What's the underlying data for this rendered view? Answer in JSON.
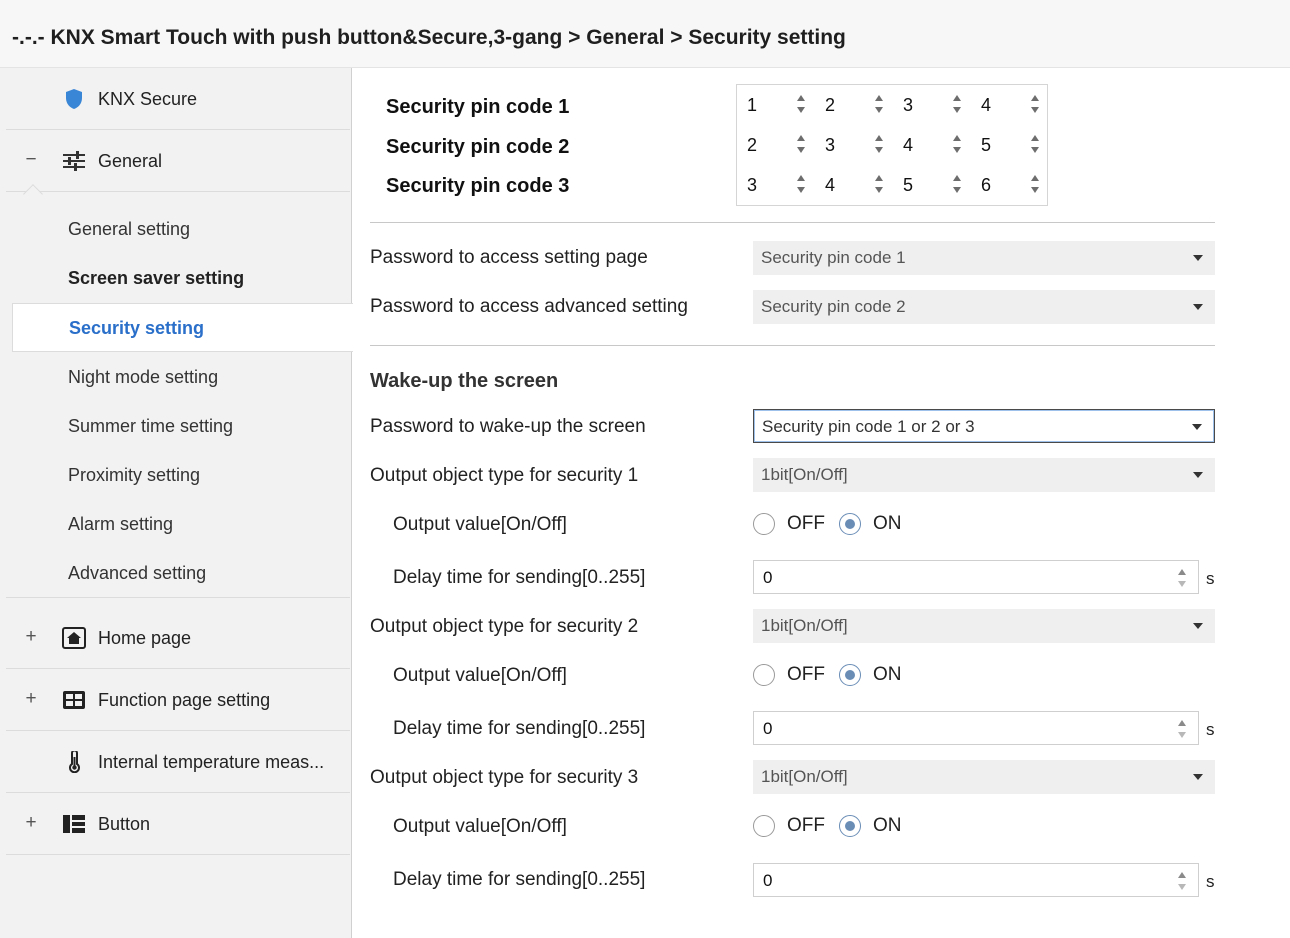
{
  "header": {
    "breadcrumb": "-.-.- KNX Smart Touch with push button&Secure,3-gang > General > Security setting"
  },
  "sidebar": {
    "knx_secure": "KNX Secure",
    "general": {
      "toggle": "−",
      "label": "General"
    },
    "general_items": [
      "General setting",
      "Screen saver setting",
      "Security setting",
      "Night mode setting",
      "Summer time setting",
      "Proximity setting",
      "Alarm setting",
      "Advanced setting"
    ],
    "home_page": {
      "toggle": "+",
      "label": "Home page"
    },
    "function_page": {
      "toggle": "+",
      "label": "Function page setting"
    },
    "internal_temp": {
      "label": "Internal temperature meas..."
    },
    "button": {
      "toggle": "+",
      "label": "Button"
    }
  },
  "pins": {
    "labels": [
      "Security pin code 1",
      "Security pin code 2",
      "Security pin code 3"
    ],
    "rows": [
      [
        "1",
        "2",
        "3",
        "4"
      ],
      [
        "2",
        "3",
        "4",
        "5"
      ],
      [
        "3",
        "4",
        "5",
        "6"
      ]
    ]
  },
  "access": {
    "setting_page_label": "Password to access setting page",
    "setting_page_value": "Security pin code 1",
    "advanced_label": "Password to access advanced setting",
    "advanced_value": "Security pin code 2"
  },
  "wakeup": {
    "title": "Wake-up the screen",
    "password_label": "Password to wake-up the screen",
    "password_value": "Security pin code 1 or 2 or 3",
    "outputs": [
      {
        "type_label": "Output object type for security 1",
        "type_value": "1bit[On/Off]",
        "value_label": "Output value[On/Off]",
        "off": "OFF",
        "on": "ON",
        "delay_label": "Delay time for sending[0..255]",
        "delay_value": "0",
        "unit": "s"
      },
      {
        "type_label": "Output object type for security 2",
        "type_value": "1bit[On/Off]",
        "value_label": "Output value[On/Off]",
        "off": "OFF",
        "on": "ON",
        "delay_label": "Delay time for sending[0..255]",
        "delay_value": "0",
        "unit": "s"
      },
      {
        "type_label": "Output object type for security 3",
        "type_value": "1bit[On/Off]",
        "value_label": "Output value[On/Off]",
        "off": "OFF",
        "on": "ON",
        "delay_label": "Delay time for sending[0..255]",
        "delay_value": "0",
        "unit": "s"
      }
    ]
  },
  "colors": {
    "accent": "#2a6fc9",
    "shield": "#3a86d6",
    "radio_selected": "#6a8db6"
  }
}
